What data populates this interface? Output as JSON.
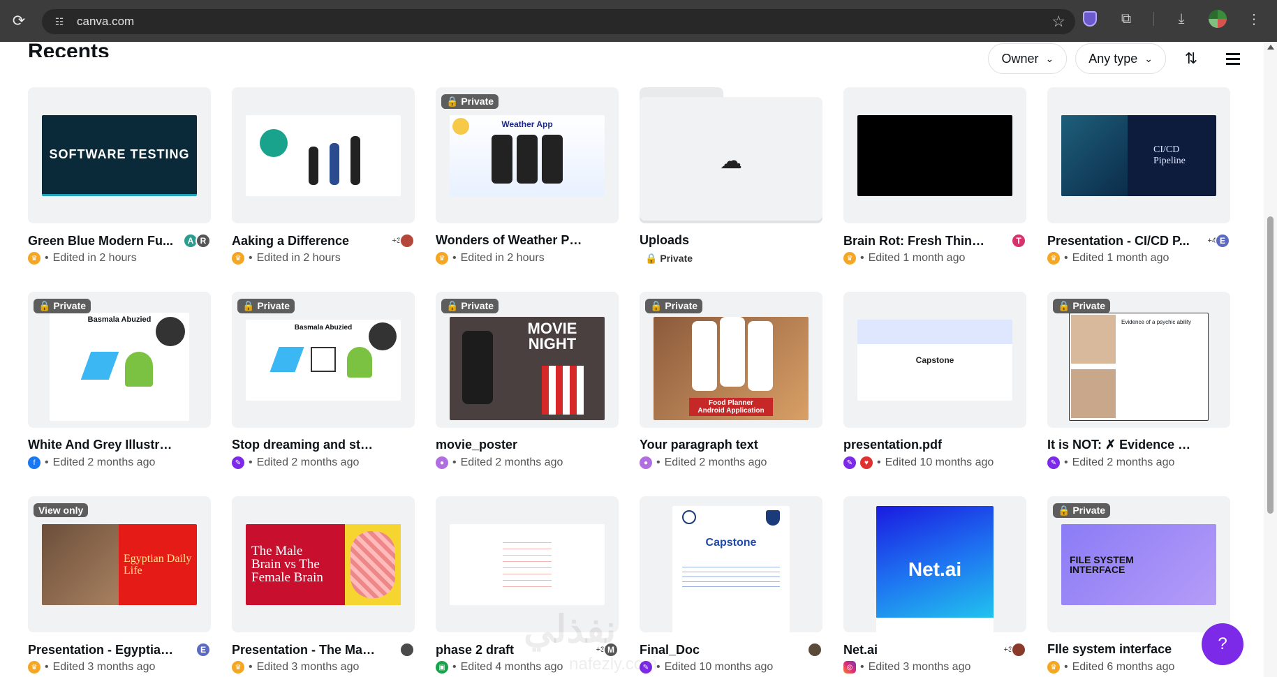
{
  "browser": {
    "url": "canva.com"
  },
  "page": {
    "heading": "Recents"
  },
  "toolbar": {
    "owner_label": "Owner",
    "type_label": "Any type"
  },
  "items": [
    {
      "title": "Green Blue Modern Fu...",
      "meta": "Edited in 2 hours",
      "badge": "",
      "art_text": "SOFTWARE TESTING",
      "collab": [
        "A",
        "R"
      ],
      "plus": ""
    },
    {
      "title": "Aaking a Difference",
      "meta": "Edited in 2 hours",
      "badge": "",
      "art_text": "",
      "collab": [],
      "plus": "+3"
    },
    {
      "title": "Wonders of Weather Presen...",
      "meta": "Edited in 2 hours",
      "badge": "Private",
      "art_text": "Weather App",
      "collab": [],
      "plus": ""
    },
    {
      "title": "Uploads",
      "meta": "Private",
      "badge": "",
      "art_text": "",
      "collab": [],
      "plus": ""
    },
    {
      "title": "Brain Rot: Fresh Thinkin...",
      "meta": "Edited 1 month ago",
      "badge": "",
      "art_text": "",
      "collab": [
        "T"
      ],
      "plus": ""
    },
    {
      "title": "Presentation - CI/CD P...",
      "meta": "Edited 1 month ago",
      "badge": "",
      "art_text": "CI/CD Pipeline",
      "collab": [
        "E"
      ],
      "plus": "+4"
    },
    {
      "title": "White And Grey Illustration ...",
      "meta": "Edited 2 months ago",
      "badge": "Private",
      "art_text": "Basmala Abuzied",
      "collab": [],
      "plus": ""
    },
    {
      "title": "Stop dreaming and start doi...",
      "meta": "Edited 2 months ago",
      "badge": "Private",
      "art_text": "Basmala Abuzied",
      "collab": [],
      "plus": ""
    },
    {
      "title": "movie_poster",
      "meta": "Edited 2 months ago",
      "badge": "Private",
      "art_text": "MOVIE NIGHT",
      "collab": [],
      "plus": ""
    },
    {
      "title": "Your paragraph text",
      "meta": "Edited 2 months ago",
      "badge": "Private",
      "art_text": "Food Planner Android Application",
      "collab": [],
      "plus": ""
    },
    {
      "title": "presentation.pdf",
      "meta": "Edited 10 months ago",
      "badge": "",
      "art_text": "Capstone",
      "collab": [],
      "plus": ""
    },
    {
      "title": "It is NOT: ✗ Evidence of a ps...",
      "meta": "Edited 2 months ago",
      "badge": "Private",
      "art_text": "Evidence of a psychic ability",
      "collab": [],
      "plus": ""
    },
    {
      "title": "Presentation - Egyptian ...",
      "meta": "Edited 3 months ago",
      "badge": "View only",
      "art_text": "Egyptian Daily Life",
      "collab": [
        "E"
      ],
      "plus": ""
    },
    {
      "title": "Presentation - The Male ...",
      "meta": "Edited 3 months ago",
      "badge": "",
      "art_text": "The Male Brain vs The Female Brain",
      "collab": [
        ""
      ],
      "plus": ""
    },
    {
      "title": "phase 2 draft",
      "meta": "Edited 4 months ago",
      "badge": "",
      "art_text": "",
      "collab": [
        "M"
      ],
      "plus": "+3"
    },
    {
      "title": "Final_Doc",
      "meta": "Edited 10 months ago",
      "badge": "",
      "art_text": "Capstone",
      "collab": [
        ""
      ],
      "plus": ""
    },
    {
      "title": "Net.ai",
      "meta": "Edited 3 months ago",
      "badge": "",
      "art_text": "Net.ai",
      "collab": [
        ""
      ],
      "plus": "+3"
    },
    {
      "title": "FIle system interface",
      "meta": "Edited 6 months ago",
      "badge": "Private",
      "art_text": "FILE SYSTEM INTERFACE",
      "collab": [],
      "plus": ""
    }
  ],
  "help": {
    "label": "?"
  },
  "watermark": {
    "text": "نفذلي",
    "sub": "nafezly.com"
  },
  "colors": {
    "canva_purple": "#7d2ae8",
    "chrome_dark": "#3c3c3c"
  }
}
